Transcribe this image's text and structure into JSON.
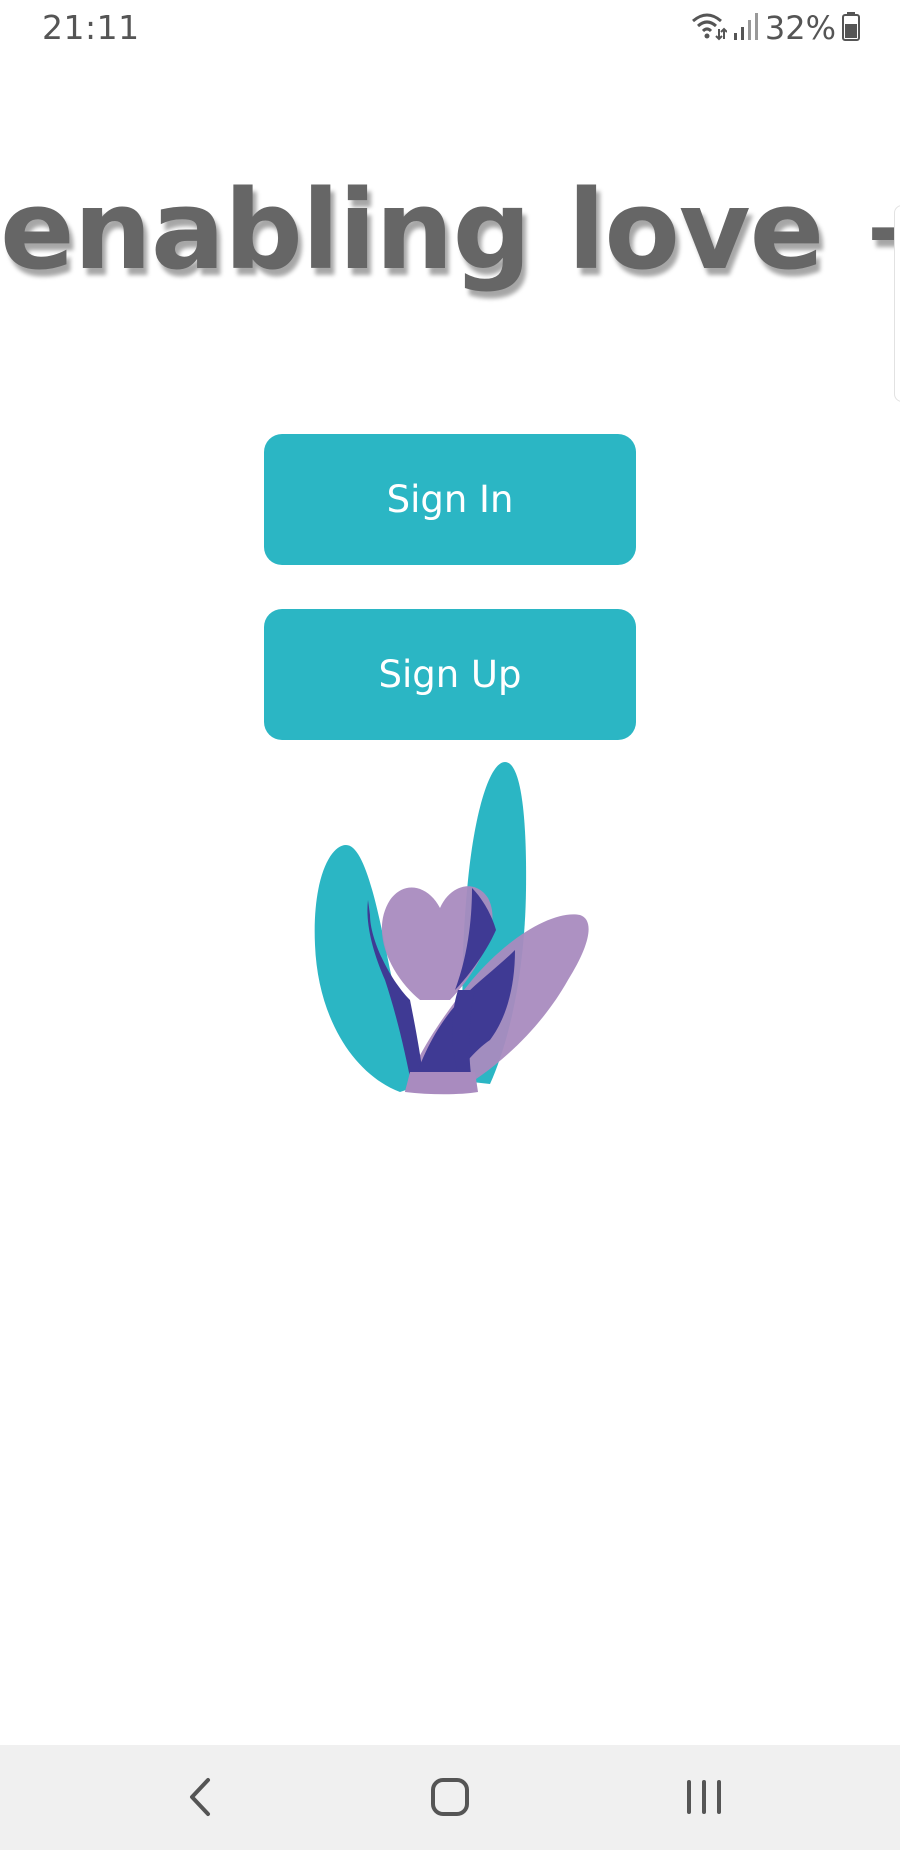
{
  "status_bar": {
    "time": "21:11",
    "battery_percent": "32%",
    "icons": [
      "wifi-icon",
      "signal-icon",
      "battery-icon"
    ]
  },
  "app": {
    "title": "enabling love +"
  },
  "buttons": {
    "sign_in_label": "Sign In",
    "sign_up_label": "Sign Up"
  },
  "logo": {
    "name": "enabling-love-logo",
    "colors": {
      "teal": "#2bb6c4",
      "lilac": "#a98bbf",
      "indigo": "#3f3a94"
    }
  },
  "navigation": {
    "icons": [
      "back-icon",
      "home-icon",
      "recents-icon"
    ]
  },
  "colors": {
    "accent": "#2bb6c4",
    "title_text": "#666666",
    "nav_background": "#f0f0f0"
  }
}
